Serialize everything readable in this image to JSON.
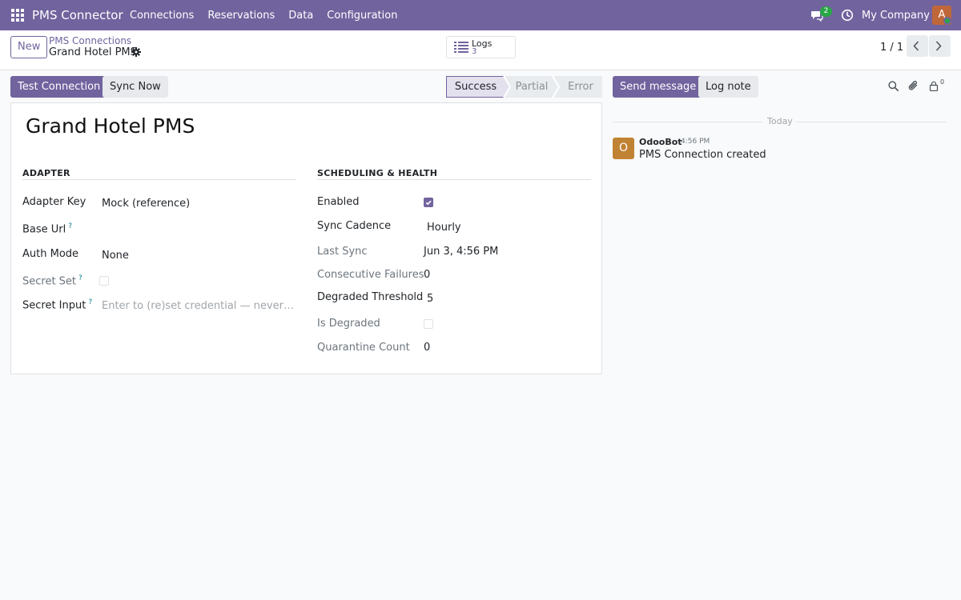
{
  "navbar": {
    "brand": "PMS Connector",
    "menu": [
      "Connections",
      "Reservations",
      "Data",
      "Configuration"
    ],
    "chat_count": "2",
    "company": "My Company",
    "avatar_initial": "A"
  },
  "control": {
    "new_label": "New",
    "breadcrumb_parent": "PMS Connections",
    "breadcrumb_current": "Grand Hotel PMS",
    "smart_button": {
      "label": "Logs",
      "count": "3"
    },
    "pager": "1 / 1"
  },
  "header": {
    "test_connection": "Test Connection",
    "sync_now": "Sync Now",
    "stages": [
      "Success",
      "Partial",
      "Error"
    ],
    "active_stage": "Success"
  },
  "form": {
    "title": "Grand Hotel PMS",
    "adapter": {
      "heading": "ADAPTER",
      "adapter_key_label": "Adapter Key",
      "adapter_key_value": "Mock (reference)",
      "base_url_label": "Base Url",
      "auth_mode_label": "Auth Mode",
      "auth_mode_value": "None",
      "secret_set_label": "Secret Set",
      "secret_input_label": "Secret Input",
      "secret_input_placeholder": "Enter to (re)set credential — never displayed",
      "help_mark": "?"
    },
    "scheduling": {
      "heading": "SCHEDULING & HEALTH",
      "enabled_label": "Enabled",
      "sync_cadence_label": "Sync Cadence",
      "sync_cadence_value": "Hourly",
      "last_sync_label": "Last Sync",
      "last_sync_value": "Jun 3, 4:56 PM",
      "consecutive_failures_label": "Consecutive Failures",
      "consecutive_failures_value": "0",
      "degraded_threshold_label": "Degraded Threshold",
      "degraded_threshold_value": "5",
      "is_degraded_label": "Is Degraded",
      "quarantine_count_label": "Quarantine Count",
      "quarantine_count_value": "0"
    }
  },
  "chatter": {
    "send_message": "Send message",
    "log_note": "Log note",
    "followers_count": "0",
    "date_separator": "Today",
    "message": {
      "avatar_initial": "O",
      "author": "OdooBot",
      "time": "4:56 PM",
      "body": "PMS Connection created"
    }
  },
  "colors": {
    "brand": "#71639e",
    "success_badge": "#28a745",
    "link": "#71639e"
  }
}
